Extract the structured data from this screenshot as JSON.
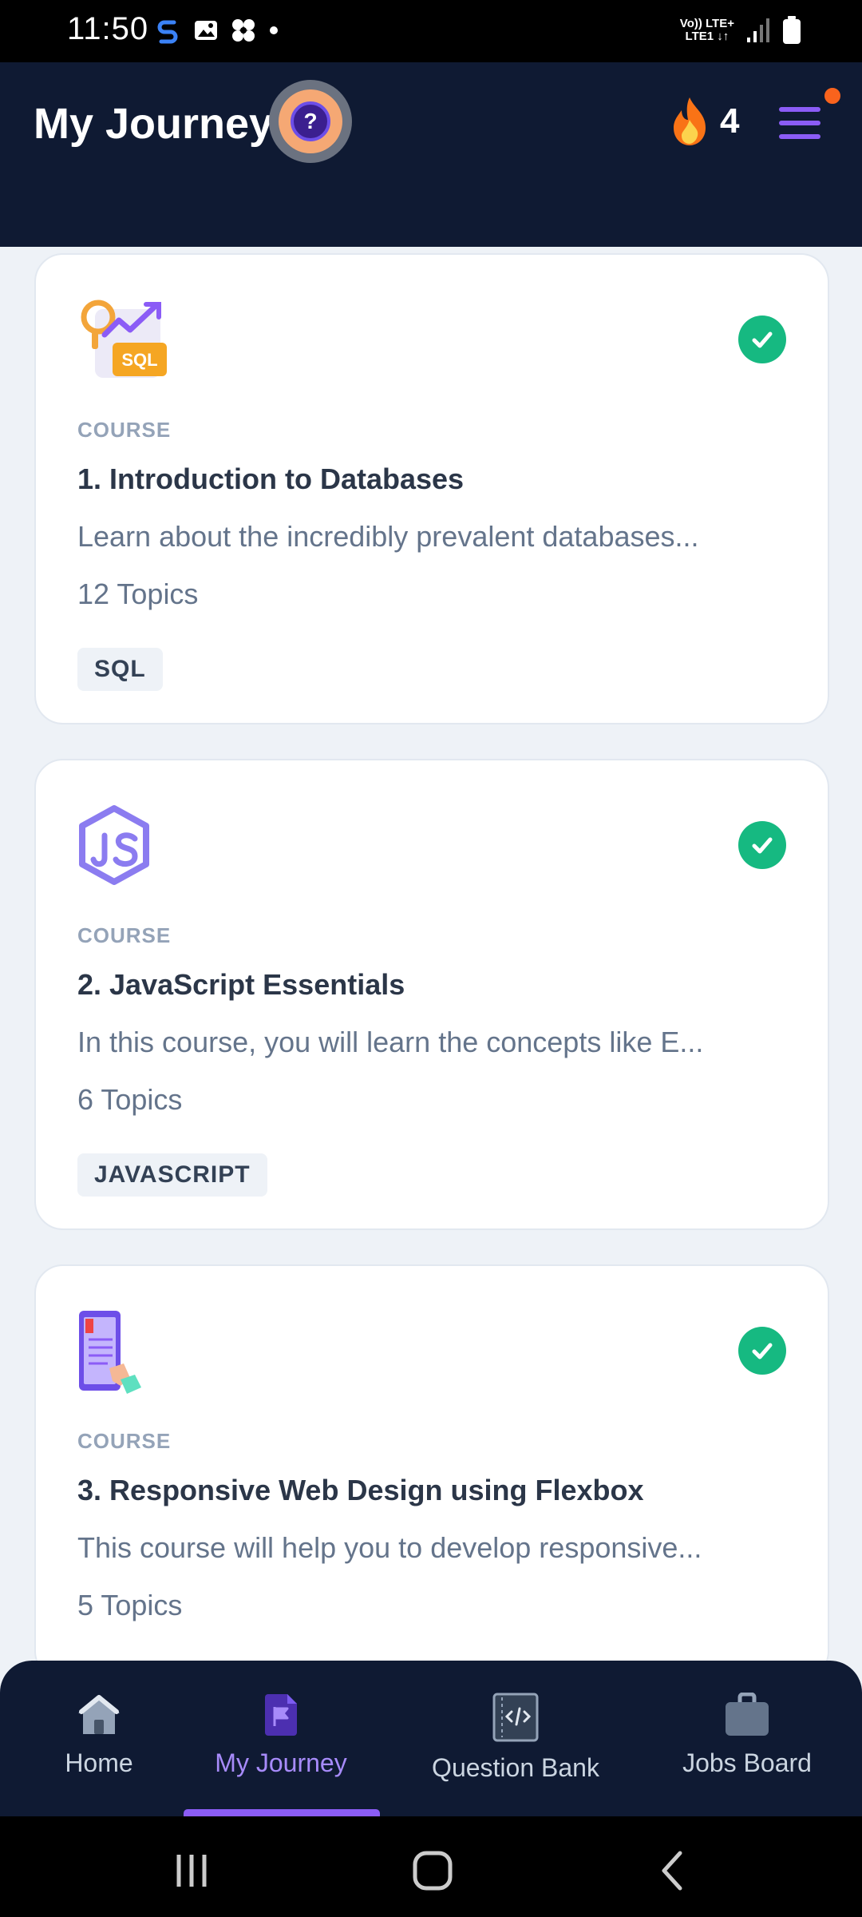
{
  "status_bar": {
    "time": "11:50",
    "network_line1": "Vo)) LTE+",
    "network_line2": "LTE1 ↓↑"
  },
  "header": {
    "title": "My Journey",
    "help_symbol": "?",
    "streak_count": "4"
  },
  "courses": [
    {
      "label": "COURSE",
      "title": "1. Introduction to Databases",
      "description": "Learn about the incredibly prevalent databases...",
      "topics": "12 Topics",
      "tag": "SQL",
      "icon": "sql-course-icon",
      "completed": true
    },
    {
      "label": "COURSE",
      "title": "2. JavaScript Essentials",
      "description": "In this course, you will learn the concepts like E...",
      "topics": "6 Topics",
      "tag": "JAVASCRIPT",
      "icon": "javascript-course-icon",
      "completed": true
    },
    {
      "label": "COURSE",
      "title": "3. Responsive Web Design using Flexbox",
      "description": "This course will help you to develop responsive...",
      "topics": "5 Topics",
      "icon": "mobile-design-course-icon",
      "completed": true
    }
  ],
  "bottom_nav": {
    "home": "Home",
    "journey": "My Journey",
    "question_bank": "Question Bank",
    "jobs_board": "Jobs Board"
  },
  "colors": {
    "accent": "#8b5cf6",
    "header_bg": "#0f1a33",
    "success": "#16b981",
    "notification": "#f9631d"
  }
}
